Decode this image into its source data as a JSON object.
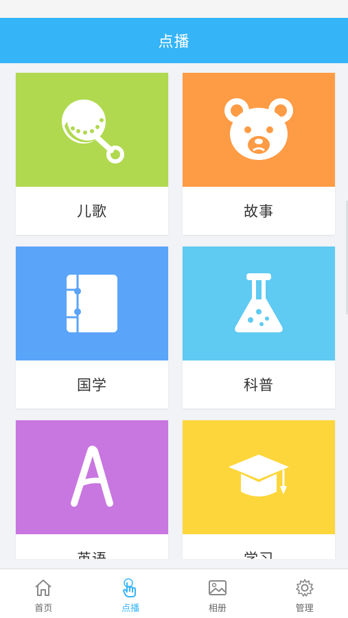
{
  "colors": {
    "header": "#35b4f8",
    "active_tab": "#35b4f8",
    "inactive_tab": "#666666"
  },
  "header": {
    "title": "点播"
  },
  "categories": [
    {
      "label": "儿歌",
      "icon": "rattle-icon",
      "color": "#b0d94f"
    },
    {
      "label": "故事",
      "icon": "bear-icon",
      "color": "#fe9b45"
    },
    {
      "label": "国学",
      "icon": "book-icon",
      "color": "#5aa4f9"
    },
    {
      "label": "科普",
      "icon": "flask-icon",
      "color": "#5fcaf2"
    },
    {
      "label": "英语",
      "icon": "letter-a-icon",
      "color": "#c876e0"
    },
    {
      "label": "学习",
      "icon": "graduation-cap-icon",
      "color": "#fdd63b"
    }
  ],
  "tabbar": {
    "active": "点播",
    "items": [
      {
        "label": "首页",
        "icon": "home-icon"
      },
      {
        "label": "点播",
        "icon": "tap-hand-icon"
      },
      {
        "label": "相册",
        "icon": "image-icon"
      },
      {
        "label": "管理",
        "icon": "gear-icon"
      }
    ]
  }
}
